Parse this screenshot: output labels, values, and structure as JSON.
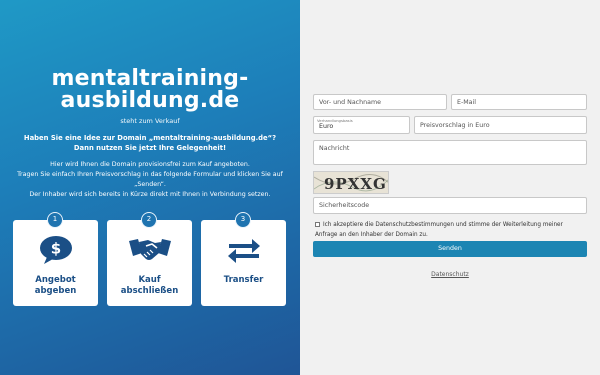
{
  "left": {
    "domain_line1": "mentaltraining-",
    "domain_line2": "ausbildung.de",
    "for_sale": "steht zum Verkauf",
    "headline_line1": "Haben Sie eine Idee zur Domain „mentaltraining-ausbildung.de“?",
    "headline_line2": "Dann nutzen Sie jetzt Ihre Gelegenheit!",
    "desc_line1": "Hier wird Ihnen die Domain provisionsfrei zum Kauf angeboten.",
    "desc_line2": "Tragen Sie einfach Ihren Preisvorschlag in das folgende Formular und klicken Sie auf „Senden“.",
    "desc_line3": "Der Inhaber wird sich bereits in Kürze direkt mit Ihnen in Verbindung setzen."
  },
  "steps": [
    {
      "number": "1",
      "line1": "Angebot",
      "line2": "abgeben",
      "icon": "dollar-speech-bubble-icon"
    },
    {
      "number": "2",
      "line1": "Kauf",
      "line2": "abschließen",
      "icon": "handshake-icon"
    },
    {
      "number": "3",
      "line1": "Transfer",
      "line2": "",
      "icon": "transfer-arrows-icon"
    }
  ],
  "form": {
    "name_placeholder": "Vor- und Nachname",
    "email_placeholder": "E-Mail",
    "currency_label": "Verhandlungsbasis",
    "currency_value": "Euro",
    "price_placeholder": "Preisvorschlag in Euro",
    "message_placeholder": "Nachricht",
    "captcha_text": "9PXXG",
    "security_placeholder": "Sicherheitscode",
    "consent_text": "Ich akzeptiere die Datenschutzbestimmungen und stimme der Weiterleitung meiner Anfrage an den Inhaber der Domain zu.",
    "send_label": "Senden",
    "privacy_link": "Datenschutz"
  },
  "colors": {
    "gradient_top": "#1f99c6",
    "gradient_bottom": "#1f5596",
    "accent": "#1c85b3",
    "card_text": "#1b4f86"
  }
}
